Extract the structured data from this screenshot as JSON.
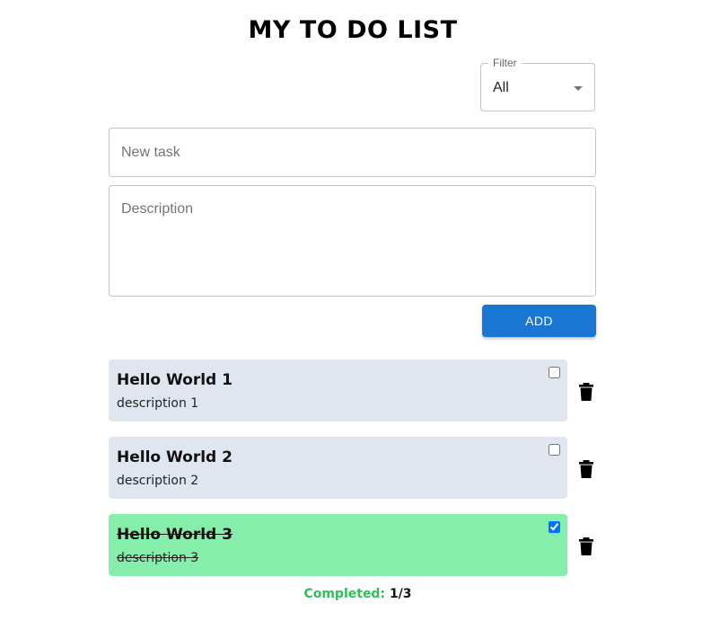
{
  "header": {
    "title": "MY TO DO LIST"
  },
  "filter": {
    "label": "Filter",
    "value": "All"
  },
  "form": {
    "task_placeholder": "New task",
    "task_value": "",
    "description_placeholder": "Description",
    "description_value": "",
    "add_label": "ADD"
  },
  "tasks": [
    {
      "title": "Hello World 1",
      "description": "description 1",
      "completed": false
    },
    {
      "title": "Hello World 2",
      "description": "description 2",
      "completed": false
    },
    {
      "title": "Hello World 3",
      "description": "description 3",
      "completed": true
    }
  ],
  "icons": {
    "delete": "trash-icon",
    "filter_caret": "caret-down-icon"
  },
  "colors": {
    "accent": "#1976d2",
    "task_pending_bg": "#e0e6ef",
    "task_done_bg": "#86eeab",
    "completed_label": "#2fbf5a"
  },
  "summary": {
    "label": "Completed:",
    "count": "1/3"
  }
}
